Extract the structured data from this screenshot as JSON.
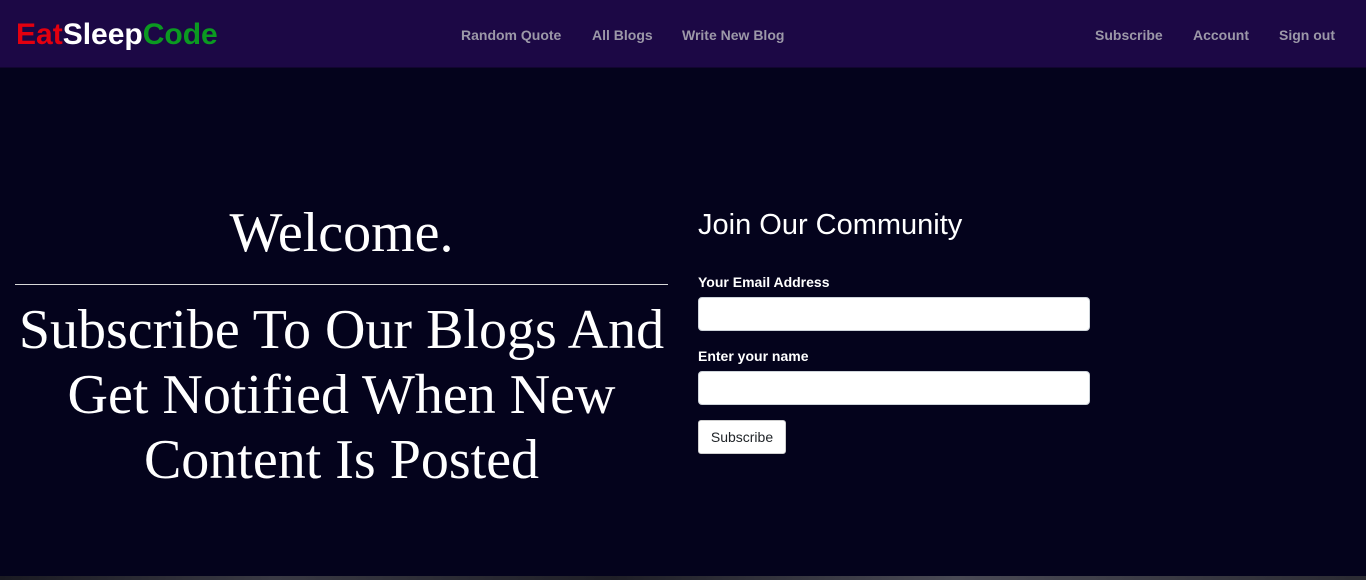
{
  "brand": {
    "part1": "Eat",
    "part2": "Sleep",
    "part3": "Code",
    "colors": {
      "part1": "#e3000f",
      "part2": "#ffffff",
      "part3": "#0b9a21"
    }
  },
  "nav": {
    "center": [
      {
        "label": "Random Quote"
      },
      {
        "label": "All Blogs"
      },
      {
        "label": "Write New Blog"
      }
    ],
    "right": [
      {
        "label": "Subscribe"
      },
      {
        "label": "Account"
      },
      {
        "label": "Sign out"
      }
    ]
  },
  "hero": {
    "welcome": "Welcome.",
    "pitch": "Subscribe To Our Blogs And Get Notified When New Content Is Posted"
  },
  "form": {
    "title": "Join Our Community",
    "email_label": "Your Email Address",
    "email_value": "",
    "name_label": "Enter your name",
    "name_value": "",
    "submit_label": "Subscribe"
  },
  "theme": {
    "navbar_bg": "#1c0845",
    "page_bg": "#04031c",
    "nav_link_color": "#9c98a8"
  }
}
